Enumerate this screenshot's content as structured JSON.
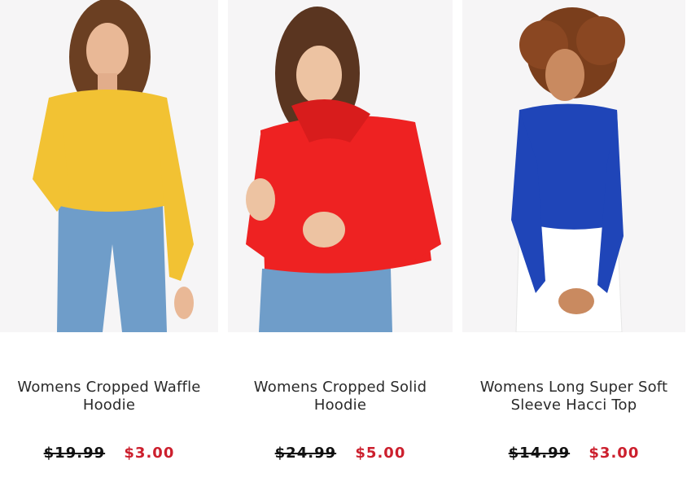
{
  "products": [
    {
      "title_line1": "Womens Cropped Waffle",
      "title_line2": "Hoodie",
      "old_price": "$19.99",
      "sale_price": "$3.00",
      "garment_color": "#f2c233"
    },
    {
      "title_line1": "Womens Cropped Solid",
      "title_line2": "Hoodie",
      "old_price": "$24.99",
      "sale_price": "$5.00",
      "garment_color": "#ee2222"
    },
    {
      "title_line1": "Womens Long Super Soft",
      "title_line2": "Sleeve Hacci Top",
      "old_price": "$14.99",
      "sale_price": "$3.00",
      "garment_color": "#1f45b8"
    }
  ],
  "colors": {
    "sale_price": "#cc1f2d",
    "old_price": "#111111",
    "title": "#2a2a2a",
    "photo_bg": "#f6f5f6"
  }
}
